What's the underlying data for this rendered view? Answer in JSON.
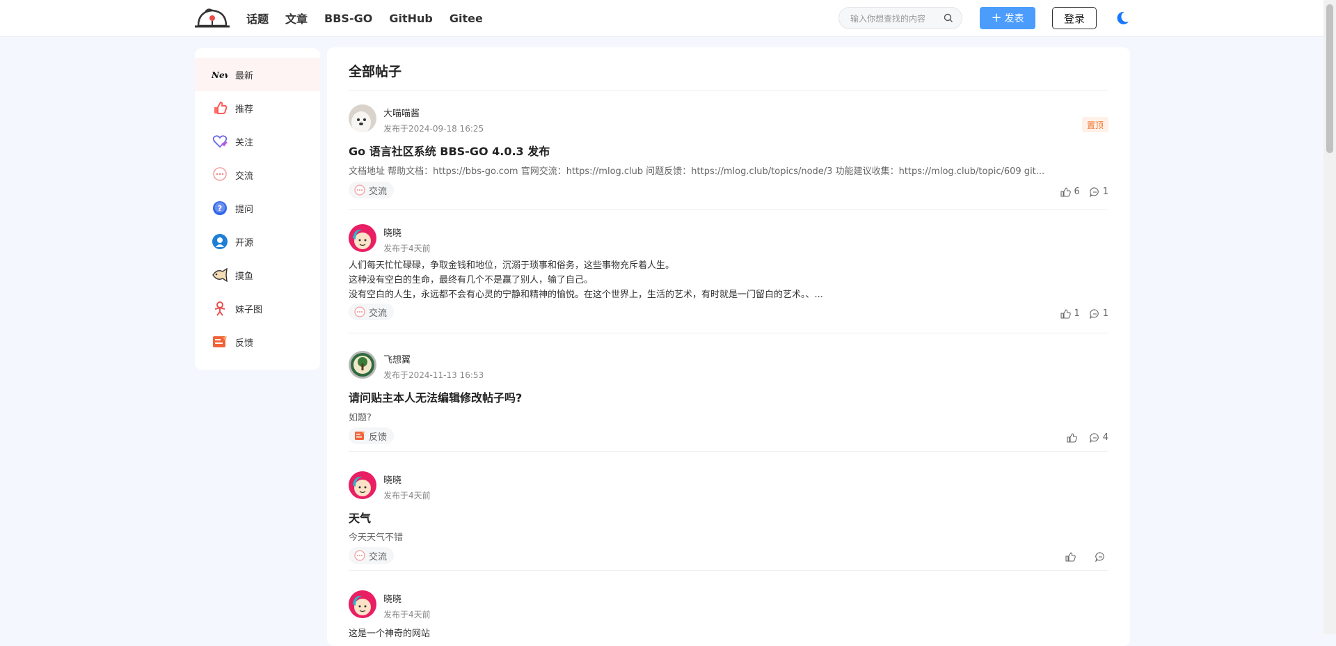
{
  "header": {
    "nav": [
      "话题",
      "文章",
      "BBS-GO",
      "GitHub",
      "Gitee"
    ],
    "search_placeholder": "输入你想查找的内容",
    "post_label": "发表",
    "login_label": "登录"
  },
  "sidebar": {
    "items": [
      {
        "label": "最新",
        "icon": "new-icon",
        "active": true
      },
      {
        "label": "推荐",
        "icon": "thumbs-up-icon"
      },
      {
        "label": "关注",
        "icon": "heart-icon"
      },
      {
        "label": "交流",
        "icon": "chat-icon"
      },
      {
        "label": "提问",
        "icon": "question-icon"
      },
      {
        "label": "开源",
        "icon": "open-source-icon"
      },
      {
        "label": "摸鱼",
        "icon": "fish-icon"
      },
      {
        "label": "妹子图",
        "icon": "girl-icon"
      },
      {
        "label": "反馈",
        "icon": "feedback-icon"
      }
    ]
  },
  "main": {
    "title": "全部帖子",
    "topics": [
      {
        "user": "大喵喵酱",
        "time": "发布于2024-09-18 16:25",
        "pinned": "置顶",
        "title": "Go 语言社区系统 BBS-GO 4.0.3 发布",
        "summary": "文档地址 帮助文档：https://bbs-go.com 官网交流：https://mlog.club 问题反馈：https://mlog.club/topics/node/3 功能建议收集：https://mlog.club/topic/609 git...",
        "tag": "交流",
        "likes": "6",
        "comments": "1"
      },
      {
        "user": "晓晓",
        "time": "发布于4天前",
        "content": [
          "人们每天忙忙碌碌，争取金钱和地位，沉溺于琐事和俗务，这些事物充斥着人生。",
          "这种没有空白的生命，最终有几个不是赢了别人，输了自己。",
          "没有空白的人生，永远都不会有心灵的宁静和精神的愉悦。在这个世界上，生活的艺术，有时就是一门留白的艺术。、..."
        ],
        "tag": "交流",
        "likes": "1",
        "comments": "1"
      },
      {
        "user": "飞想翼",
        "time": "发布于2024-11-13 16:53",
        "title": "请问贴主本人无法编辑修改帖子吗?",
        "summary": "如题?",
        "tag": "反馈",
        "likes": "",
        "comments": "4"
      },
      {
        "user": "晓晓",
        "time": "发布于4天前",
        "title": "天气",
        "summary": "今天天气不错",
        "tag": "交流",
        "likes": "",
        "comments": ""
      },
      {
        "user": "晓晓",
        "time": "发布于4天前",
        "content_partial": "这是一个神奇的网站"
      }
    ]
  },
  "colors": {
    "accent": "#4c9dfb",
    "page_bg": "#f4f7fd",
    "pinned": "#ee7733",
    "moon": "#1677ff"
  }
}
